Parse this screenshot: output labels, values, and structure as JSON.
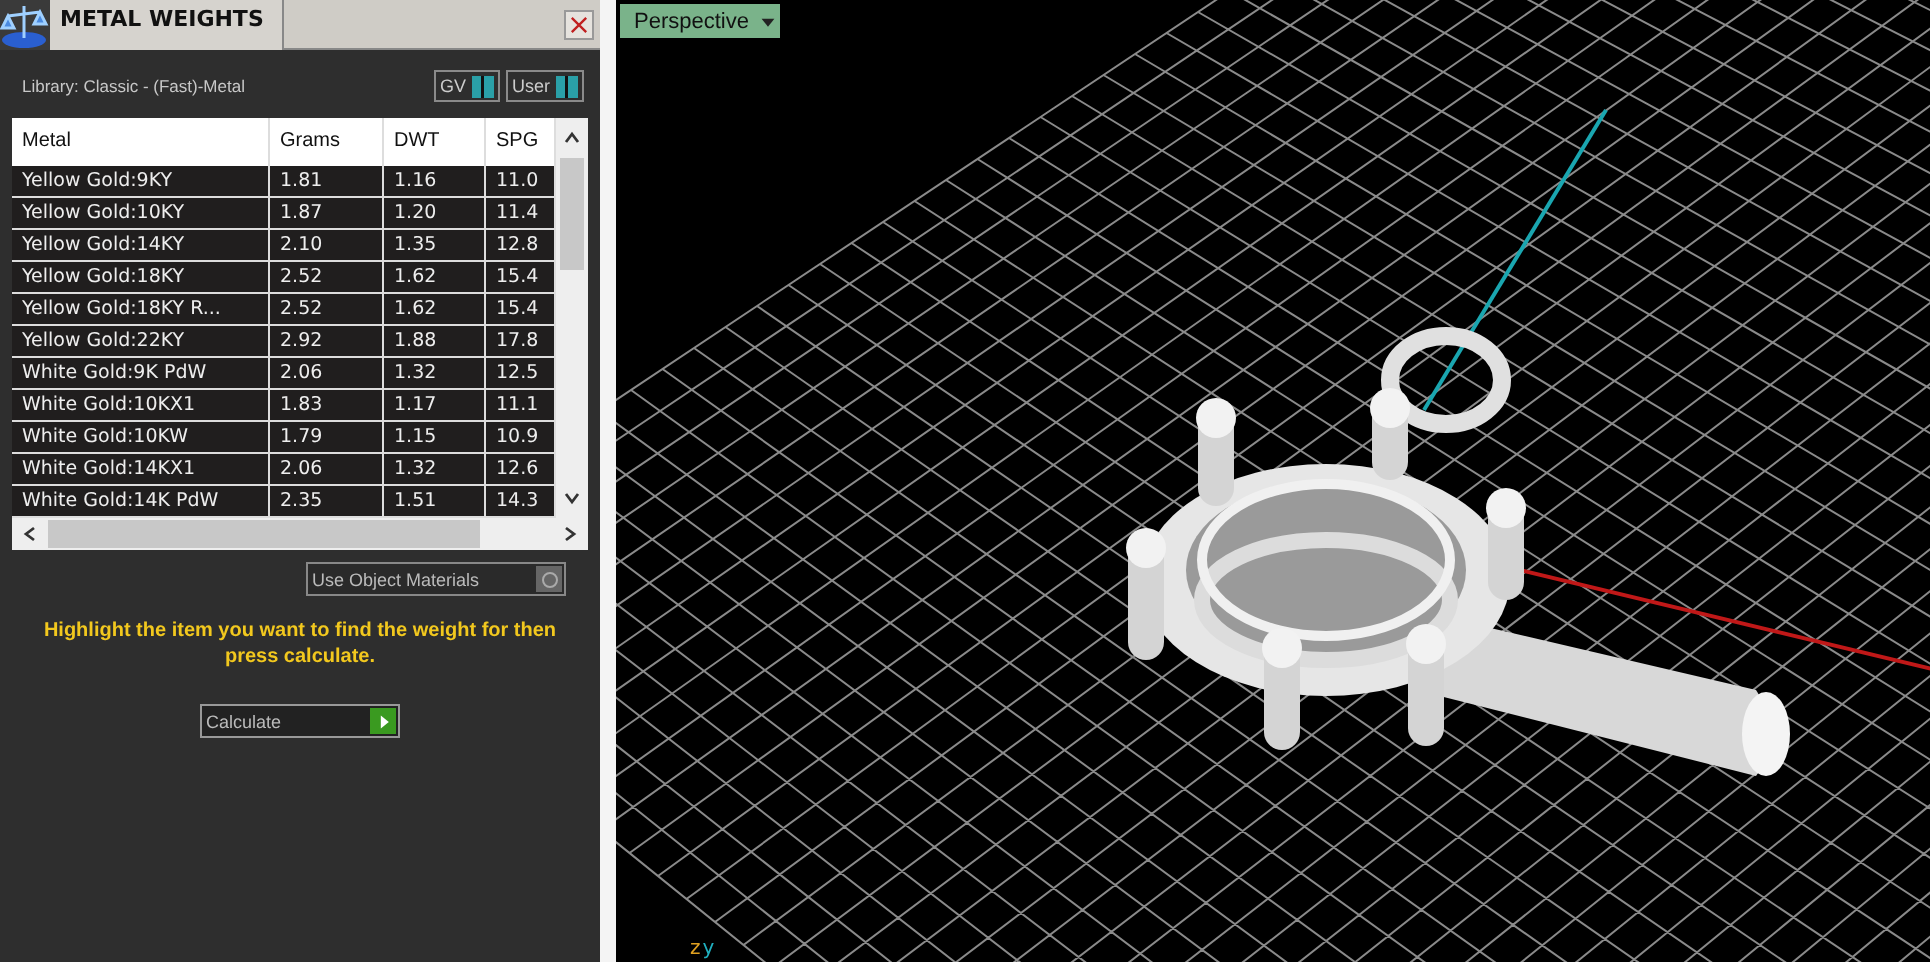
{
  "panel": {
    "title": "METAL WEIGHTS",
    "library": "Library: Classic - (Fast)-Metal",
    "toggles": [
      {
        "label": "GV",
        "on": true
      },
      {
        "label": "User",
        "on": true
      }
    ]
  },
  "table": {
    "columns": [
      "Metal",
      "Grams",
      "DWT",
      "SPG"
    ],
    "rows": [
      {
        "metal": "Yellow Gold:9KY",
        "grams": "1.81",
        "dwt": "1.16",
        "spg": "11.0"
      },
      {
        "metal": "Yellow Gold:10KY",
        "grams": "1.87",
        "dwt": "1.20",
        "spg": "11.4"
      },
      {
        "metal": "Yellow Gold:14KY",
        "grams": "2.10",
        "dwt": "1.35",
        "spg": "12.8"
      },
      {
        "metal": "Yellow Gold:18KY",
        "grams": "2.52",
        "dwt": "1.62",
        "spg": "15.4"
      },
      {
        "metal": "Yellow Gold:18KY R...",
        "grams": "2.52",
        "dwt": "1.62",
        "spg": "15.4"
      },
      {
        "metal": "Yellow Gold:22KY",
        "grams": "2.92",
        "dwt": "1.88",
        "spg": "17.8"
      },
      {
        "metal": "White Gold:9K PdW",
        "grams": "2.06",
        "dwt": "1.32",
        "spg": "12.5"
      },
      {
        "metal": "White Gold:10KX1",
        "grams": "1.83",
        "dwt": "1.17",
        "spg": "11.1"
      },
      {
        "metal": "White Gold:10KW",
        "grams": "1.79",
        "dwt": "1.15",
        "spg": "10.9"
      },
      {
        "metal": "White Gold:14KX1",
        "grams": "2.06",
        "dwt": "1.32",
        "spg": "12.6"
      },
      {
        "metal": "White Gold:14K PdW",
        "grams": "2.35",
        "dwt": "1.51",
        "spg": "14.3"
      }
    ]
  },
  "use_object_materials": {
    "label": "Use Object Materials",
    "checked": false
  },
  "hint": "Highlight the item you want to find the weight for then press calculate.",
  "calculate_button": "Calculate",
  "viewport": {
    "view_button": "Perspective",
    "axis_labels": [
      "z",
      "y"
    ]
  }
}
